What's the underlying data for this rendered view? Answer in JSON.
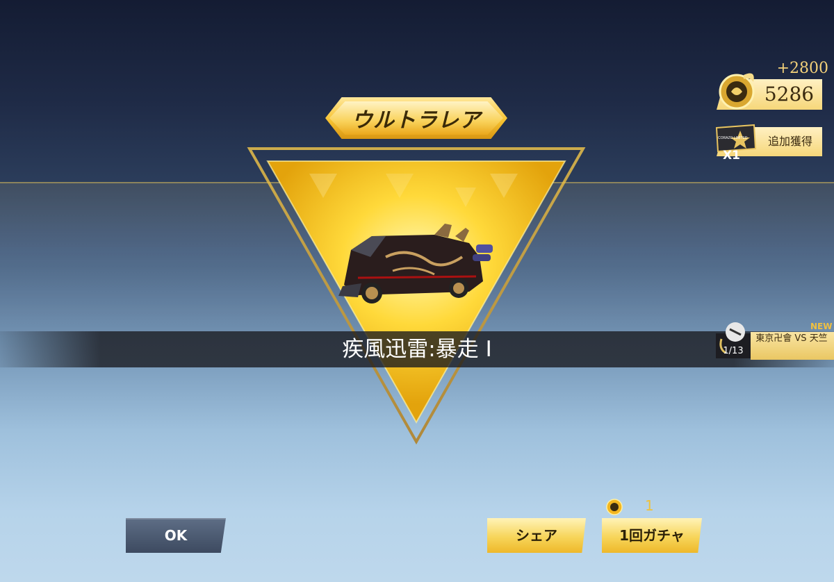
{
  "rarity": {
    "label": "ウルトラレア"
  },
  "item": {
    "name": "疾風迅雷:暴走 Ⅰ"
  },
  "currency": {
    "amount": "5286",
    "gain": "+2800",
    "icon": "gold-emblem-icon"
  },
  "ticket": {
    "label": "追加獲得",
    "count": "X1",
    "icon": "limited-ticket-icon",
    "icon_text": "CORAZO LIMITED"
  },
  "event": {
    "badge": "NEW",
    "title": "東京卍會 VS 天竺",
    "progress": "1/13",
    "icon": "event-character-icon"
  },
  "cost": {
    "icon": "coin-icon",
    "value": "1"
  },
  "buttons": {
    "ok": "OK",
    "share": "シェア",
    "gacha": "1回ガチャ"
  },
  "colors": {
    "gold": "#f7c332",
    "dark_button": "#3d4a60",
    "sky_top": "#141c33",
    "sky_bottom": "#bed8ec"
  }
}
